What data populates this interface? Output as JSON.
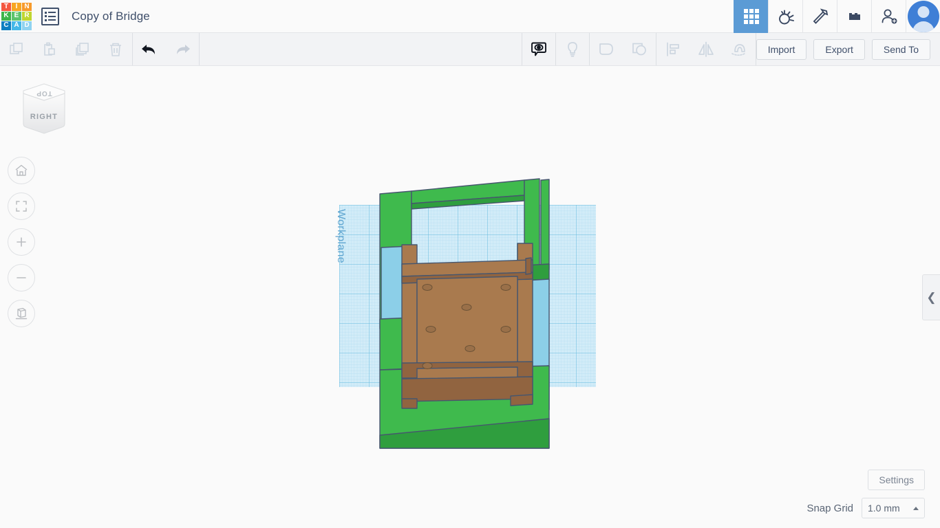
{
  "app": {
    "name": "Tinkercad",
    "logo_tiles": [
      {
        "letter": "T",
        "color": "#f4563f"
      },
      {
        "letter": "I",
        "color": "#f7a623"
      },
      {
        "letter": "N",
        "color": "#f79a2b"
      },
      {
        "letter": "K",
        "color": "#3db54a"
      },
      {
        "letter": "E",
        "color": "#5dc46b"
      },
      {
        "letter": "R",
        "color": "#bfd62f"
      },
      {
        "letter": "C",
        "color": "#0e7fc1"
      },
      {
        "letter": "A",
        "color": "#45b8e8"
      },
      {
        "letter": "D",
        "color": "#8fd3f0"
      }
    ],
    "accent_blue": "#5b9bd5",
    "text_color": "#40506b"
  },
  "header": {
    "docs_icon": "document-list-icon",
    "project_title": "Copy of Bridge",
    "icons": [
      {
        "name": "grid-view-icon",
        "label": "Gallery",
        "active": true
      },
      {
        "name": "tinker-lamp-icon",
        "label": "Tinker",
        "active": false
      },
      {
        "name": "pickaxe-icon",
        "label": "Minecraft",
        "active": false
      },
      {
        "name": "lego-brick-icon",
        "label": "Blocks",
        "active": false
      },
      {
        "name": "add-person-icon",
        "label": "Invite",
        "active": false
      }
    ],
    "avatar": "user-avatar"
  },
  "toolbar": {
    "left_tools": [
      {
        "name": "copy-icon",
        "label": "Copy",
        "enabled": false
      },
      {
        "name": "paste-icon",
        "label": "Paste",
        "enabled": false
      },
      {
        "name": "duplicate-icon",
        "label": "Duplicate",
        "enabled": false
      },
      {
        "name": "delete-icon",
        "label": "Delete",
        "enabled": false
      }
    ],
    "history_tools": [
      {
        "name": "undo-icon",
        "label": "Undo",
        "enabled": true
      },
      {
        "name": "redo-icon",
        "label": "Redo",
        "enabled": false
      }
    ],
    "center_tools": [
      {
        "name": "show-hide-icon",
        "label": "Show/Hide",
        "enabled": true
      },
      {
        "name": "lightbulb-icon",
        "label": "Hint",
        "enabled": false
      },
      {
        "name": "group-icon",
        "label": "Group",
        "enabled": false
      },
      {
        "name": "ungroup-icon",
        "label": "Ungroup",
        "enabled": false
      },
      {
        "name": "align-icon",
        "label": "Align",
        "enabled": false
      },
      {
        "name": "mirror-icon",
        "label": "Mirror",
        "enabled": false
      },
      {
        "name": "magnet-icon",
        "label": "Snap",
        "enabled": false
      }
    ],
    "import_label": "Import",
    "export_label": "Export",
    "send_to_label": "Send To"
  },
  "canvas": {
    "viewcube": {
      "top_face_label": "TOP",
      "front_face_label": "RIGHT"
    },
    "nav_buttons": [
      {
        "name": "home-view-icon",
        "label": "Home view"
      },
      {
        "name": "fit-to-view-icon",
        "label": "Fit all in view"
      },
      {
        "name": "zoom-in-icon",
        "label": "Zoom in"
      },
      {
        "name": "zoom-out-icon",
        "label": "Zoom out"
      },
      {
        "name": "perspective-toggle-icon",
        "label": "Switch to orthographic view"
      }
    ],
    "workplane_label": "Workplane",
    "model": {
      "name": "bridge-model",
      "colors": {
        "grass_light": "#3fba4d",
        "grass_dark": "#2f9e3e",
        "wood_light": "#a97a4e",
        "wood_dark": "#916440",
        "water": "#8ccfe8",
        "outline": "#46566e",
        "hole": "#9a7049"
      }
    }
  },
  "right_panel": {
    "collapse_icon": "chevron-left-icon"
  },
  "footer": {
    "settings_label": "Settings",
    "snap_grid_label": "Snap Grid",
    "snap_grid_value": "1.0 mm",
    "snap_caret": "caret-up-icon"
  }
}
